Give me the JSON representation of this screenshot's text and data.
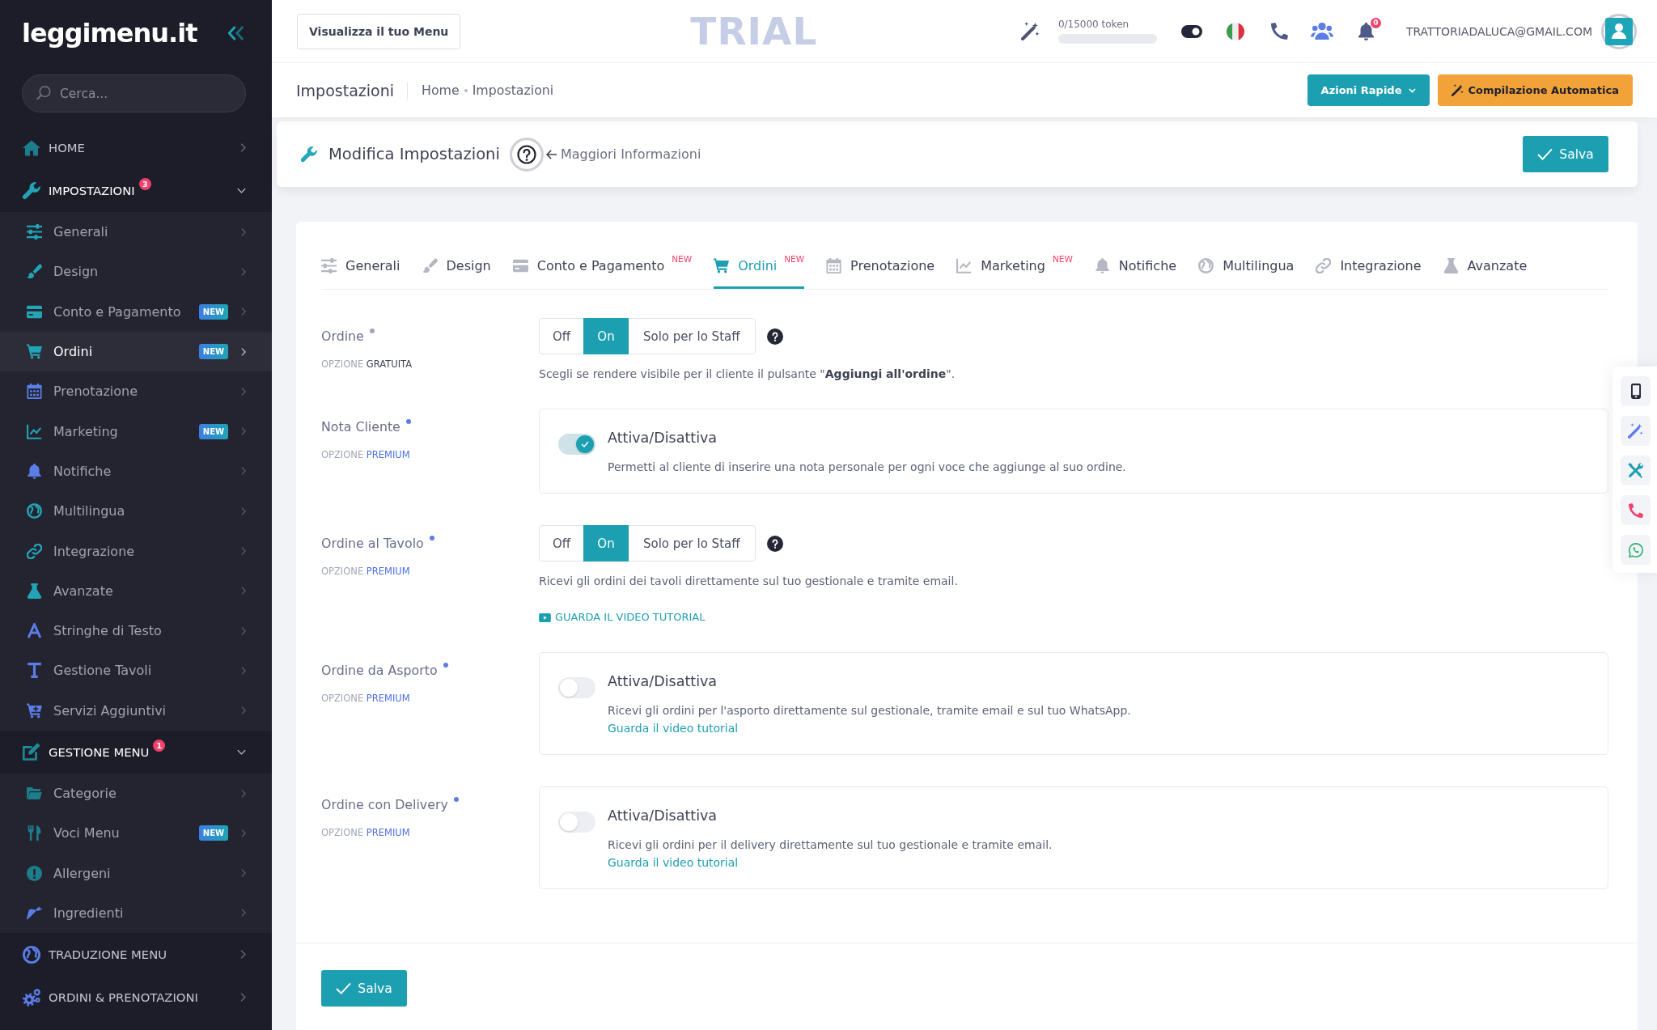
{
  "sidebar": {
    "logo": "leggimenu.it",
    "search": {
      "placeholder": "Cerca..."
    },
    "sections": [
      {
        "label": "HOME",
        "expanded": false
      },
      {
        "label": "IMPOSTAZIONI",
        "badge": "3",
        "expanded": true,
        "children": [
          {
            "label": "Generali",
            "selected": false
          },
          {
            "label": "Design",
            "selected": false
          },
          {
            "label": "Conto e Pagamento",
            "badge": "NEW",
            "selected": false
          },
          {
            "label": "Ordini",
            "badge": "NEW",
            "selected": true
          },
          {
            "label": "Prenotazione",
            "selected": false
          },
          {
            "label": "Marketing",
            "badge": "NEW",
            "selected": false
          },
          {
            "label": "Notifiche",
            "selected": false
          },
          {
            "label": "Multilingua",
            "selected": false
          },
          {
            "label": "Integrazione",
            "selected": false
          },
          {
            "label": "Avanzate",
            "selected": false
          },
          {
            "label": "Stringhe di Testo",
            "selected": false
          },
          {
            "label": "Gestione Tavoli",
            "selected": false
          },
          {
            "label": "Servizi Aggiuntivi",
            "selected": false
          }
        ]
      },
      {
        "label": "GESTIONE MENU",
        "badge": "1",
        "expanded": true,
        "children": [
          {
            "label": "Categorie",
            "selected": false
          },
          {
            "label": "Voci Menu",
            "badge": "NEW",
            "selected": false
          },
          {
            "label": "Allergeni",
            "selected": false
          },
          {
            "label": "Ingredienti",
            "selected": false
          }
        ]
      },
      {
        "label": "TRADUZIONE MENU",
        "expanded": false
      },
      {
        "label": "ORDINI & PRENOTAZIONI",
        "expanded": false
      }
    ]
  },
  "topbar": {
    "view_menu_button": "Visualizza il tuo Menu",
    "trial_label": "TRIAL",
    "tokens": {
      "label": "0/15000 token",
      "level": 0
    },
    "notifications_badge": "0",
    "user_email": "TRATTORIADALUCA@GMAIL.COM"
  },
  "page_header": {
    "title": "Impostazioni",
    "breadcrumb": [
      "Home",
      "Impostazioni"
    ],
    "buttons": [
      {
        "label": "Azioni Rapide",
        "kind": "dropdown"
      },
      {
        "label": "Compilazione Automatica",
        "kind": "autofill"
      }
    ]
  },
  "edit_bar": {
    "title": "Modifica Impostazioni",
    "info_link": "Maggiori Informazioni",
    "save_button": "Salva"
  },
  "tabs": [
    {
      "label": "Generali",
      "selected": false
    },
    {
      "label": "Design",
      "selected": false
    },
    {
      "label": "Conto e Pagamento",
      "badge": "NEW",
      "selected": false
    },
    {
      "label": "Ordini",
      "badge": "NEW",
      "selected": true
    },
    {
      "label": "Prenotazione",
      "selected": false
    },
    {
      "label": "Marketing",
      "badge": "NEW",
      "selected": false
    },
    {
      "label": "Notifiche",
      "selected": false
    },
    {
      "label": "Multilingua",
      "selected": false
    },
    {
      "label": "Integrazione",
      "selected": false
    },
    {
      "label": "Avanzate",
      "selected": false
    }
  ],
  "settings": [
    {
      "label": "Ordine",
      "option": {
        "prefix": "OPZIONE",
        "tier": "GRATUITA",
        "premium": false
      },
      "kind": "segmented",
      "options": [
        {
          "label": "Off",
          "selected": false
        },
        {
          "label": "On",
          "selected": true
        },
        {
          "label": "Solo per lo Staff",
          "selected": false
        }
      ],
      "description": "Scegli se rendere visibile per il cliente il pulsante \"**Aggiungi all'ordine**\"."
    },
    {
      "label": "Nota Cliente",
      "option": {
        "prefix": "OPZIONE",
        "tier": "PREMIUM",
        "premium": true
      },
      "kind": "switch",
      "switch": {
        "title": "Attiva/Disattiva",
        "on": true
      },
      "description": "Permetti al cliente di inserire una nota personale per ogni voce che aggiunge al suo ordine."
    },
    {
      "label": "Ordine al Tavolo",
      "option": {
        "prefix": "OPZIONE",
        "tier": "PREMIUM",
        "premium": true
      },
      "kind": "segmented",
      "options": [
        {
          "label": "Off",
          "selected": false
        },
        {
          "label": "On",
          "selected": true
        },
        {
          "label": "Solo per lo Staff",
          "selected": false
        }
      ],
      "description": "Ricevi gli ordini dei tavoli direttamente sul tuo gestionale e tramite email.",
      "link": "GUARDA IL VIDEO TUTORIAL"
    },
    {
      "label": "Ordine da Asporto",
      "option": {
        "prefix": "OPZIONE",
        "tier": "PREMIUM",
        "premium": true
      },
      "kind": "switch",
      "switch": {
        "title": "Attiva/Disattiva",
        "on": false
      },
      "description": "Ricevi gli ordini per l'asporto direttamente sul gestionale, tramite email e sul tuo WhatsApp.",
      "link": "Guarda il video tutorial"
    },
    {
      "label": "Ordine con Delivery",
      "option": {
        "prefix": "OPZIONE",
        "tier": "PREMIUM",
        "premium": true
      },
      "kind": "switch",
      "switch": {
        "title": "Attiva/Disattiva",
        "on": false
      },
      "description": "Ricevi gli ordini per il delivery direttamente sul tuo gestionale e tramite email.",
      "link": "Guarda il video tutorial"
    }
  ],
  "footer": {
    "save_button": "Salva"
  }
}
